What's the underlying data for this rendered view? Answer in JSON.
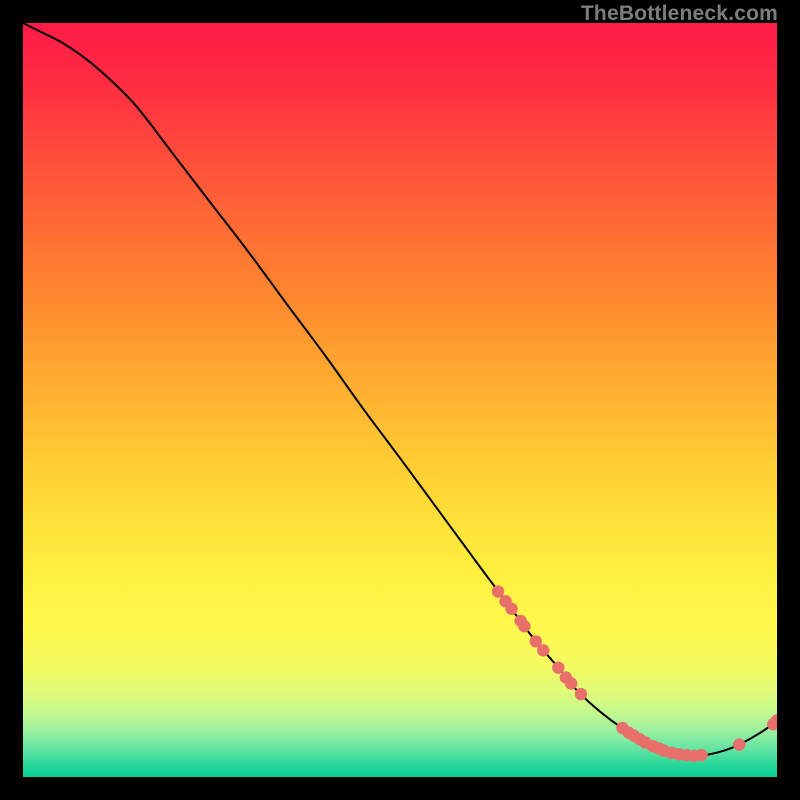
{
  "watermark": "TheBottleneck.com",
  "chart_data": {
    "type": "line",
    "title": "",
    "xlabel": "",
    "ylabel": "",
    "xlim": [
      0,
      100
    ],
    "ylim": [
      0,
      100
    ],
    "grid": false,
    "legend": false,
    "series": [
      {
        "name": "curve",
        "x": [
          0,
          2,
          5,
          8,
          11,
          15,
          20,
          25,
          30,
          35,
          40,
          45,
          50,
          55,
          60,
          62,
          65,
          68,
          71,
          73,
          75,
          77,
          79,
          81,
          83,
          85,
          87,
          89,
          91,
          93,
          95,
          98,
          100
        ],
        "y": [
          100,
          99,
          97.5,
          95.5,
          93,
          89,
          82.5,
          76,
          69.5,
          62.7,
          56,
          49,
          42.3,
          35.5,
          28.7,
          26,
          22,
          18,
          14.5,
          12,
          10,
          8.3,
          6.8,
          5.5,
          4.3,
          3.5,
          3,
          2.8,
          3,
          3.5,
          4.3,
          6,
          7.5
        ]
      }
    ],
    "markers": [
      {
        "x": 63.0,
        "y": 24.6
      },
      {
        "x": 64.0,
        "y": 23.3
      },
      {
        "x": 64.8,
        "y": 22.3
      },
      {
        "x": 66.0,
        "y": 20.7
      },
      {
        "x": 66.5,
        "y": 20.0
      },
      {
        "x": 68.0,
        "y": 18.0
      },
      {
        "x": 69.0,
        "y": 16.8
      },
      {
        "x": 71.0,
        "y": 14.5
      },
      {
        "x": 72.0,
        "y": 13.2
      },
      {
        "x": 72.7,
        "y": 12.4
      },
      {
        "x": 74.0,
        "y": 11.0
      },
      {
        "x": 79.5,
        "y": 6.5
      },
      {
        "x": 80.3,
        "y": 5.9
      },
      {
        "x": 81.0,
        "y": 5.5
      },
      {
        "x": 81.8,
        "y": 5.0
      },
      {
        "x": 82.5,
        "y": 4.6
      },
      {
        "x": 83.5,
        "y": 4.1
      },
      {
        "x": 84.3,
        "y": 3.8
      },
      {
        "x": 85.0,
        "y": 3.5
      },
      {
        "x": 86.0,
        "y": 3.2
      },
      {
        "x": 87.0,
        "y": 3.0
      },
      {
        "x": 88.0,
        "y": 2.9
      },
      {
        "x": 89.0,
        "y": 2.8
      },
      {
        "x": 90.0,
        "y": 2.9
      },
      {
        "x": 95.0,
        "y": 4.3
      },
      {
        "x": 99.5,
        "y": 7.0
      },
      {
        "x": 100.0,
        "y": 7.5
      }
    ],
    "marker_color": "#e86f6a",
    "line_color": "#000000",
    "gradient_stops": [
      {
        "offset": 0.0,
        "color": "#ff1b47"
      },
      {
        "offset": 0.08,
        "color": "#ff2d42"
      },
      {
        "offset": 0.16,
        "color": "#ff473c"
      },
      {
        "offset": 0.24,
        "color": "#ff6236"
      },
      {
        "offset": 0.32,
        "color": "#ff7b31"
      },
      {
        "offset": 0.4,
        "color": "#ff942f"
      },
      {
        "offset": 0.48,
        "color": "#ffad30"
      },
      {
        "offset": 0.56,
        "color": "#ffc633"
      },
      {
        "offset": 0.64,
        "color": "#ffdc37"
      },
      {
        "offset": 0.72,
        "color": "#ffee3e"
      },
      {
        "offset": 0.8,
        "color": "#fffa4c"
      },
      {
        "offset": 0.85,
        "color": "#f4fb5f"
      },
      {
        "offset": 0.885,
        "color": "#e2fb77"
      },
      {
        "offset": 0.915,
        "color": "#c2f88e"
      },
      {
        "offset": 0.94,
        "color": "#9af0a0"
      },
      {
        "offset": 0.965,
        "color": "#5de3a2"
      },
      {
        "offset": 0.985,
        "color": "#26d69a"
      },
      {
        "offset": 1.0,
        "color": "#07cd92"
      }
    ]
  }
}
